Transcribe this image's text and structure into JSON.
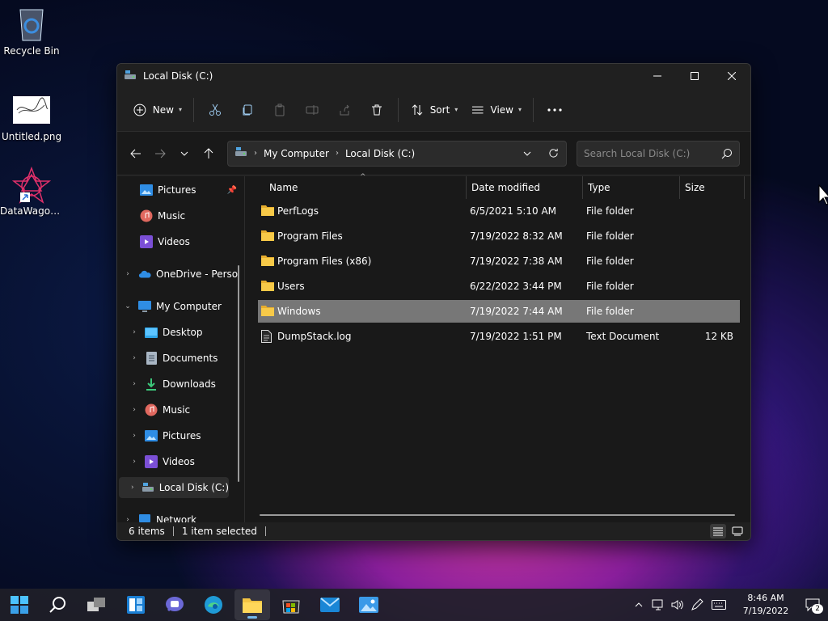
{
  "desktop": {
    "icons": [
      {
        "label": "Recycle Bin",
        "icon": "recycle-bin-icon"
      },
      {
        "label": "Untitled.png",
        "icon": "image-thumbnail-icon"
      },
      {
        "label": "DataWagon...",
        "icon": "datawagon-app-icon"
      }
    ]
  },
  "window": {
    "title": "Local Disk (C:)",
    "toolbar": {
      "new_label": "New",
      "sort_label": "Sort",
      "view_label": "View"
    },
    "address": {
      "crumbs": [
        "My Computer",
        "Local Disk (C:)"
      ]
    },
    "search": {
      "placeholder": "Search Local Disk (C:)"
    },
    "nav_pane": {
      "items": [
        {
          "label": "Pictures",
          "icon": "pictures-icon",
          "pinned": true
        },
        {
          "label": "Music",
          "icon": "music-icon"
        },
        {
          "label": "Videos",
          "icon": "videos-icon"
        },
        {
          "label": "OneDrive - Perso",
          "icon": "onedrive-icon"
        },
        {
          "label": "My Computer",
          "icon": "computer-icon"
        },
        {
          "label": "Desktop",
          "icon": "desktop-icon"
        },
        {
          "label": "Documents",
          "icon": "documents-icon"
        },
        {
          "label": "Downloads",
          "icon": "downloads-icon"
        },
        {
          "label": "Music",
          "icon": "music-icon"
        },
        {
          "label": "Pictures",
          "icon": "pictures-icon"
        },
        {
          "label": "Videos",
          "icon": "videos-icon"
        },
        {
          "label": "Local Disk (C:)",
          "icon": "drive-icon"
        },
        {
          "label": "Network",
          "icon": "network-icon"
        }
      ]
    },
    "columns": {
      "name": "Name",
      "date": "Date modified",
      "type": "Type",
      "size": "Size"
    },
    "files": [
      {
        "name": "PerfLogs",
        "date": "6/5/2021 5:10 AM",
        "type": "File folder",
        "size": "",
        "kind": "folder"
      },
      {
        "name": "Program Files",
        "date": "7/19/2022 8:32 AM",
        "type": "File folder",
        "size": "",
        "kind": "folder"
      },
      {
        "name": "Program Files (x86)",
        "date": "7/19/2022 7:38 AM",
        "type": "File folder",
        "size": "",
        "kind": "folder"
      },
      {
        "name": "Users",
        "date": "6/22/2022 3:44 PM",
        "type": "File folder",
        "size": "",
        "kind": "folder"
      },
      {
        "name": "Windows",
        "date": "7/19/2022 7:44 AM",
        "type": "File folder",
        "size": "",
        "kind": "folder",
        "selected": true
      },
      {
        "name": "DumpStack.log",
        "date": "7/19/2022 1:51 PM",
        "type": "Text Document",
        "size": "12 KB",
        "kind": "file"
      }
    ],
    "status": {
      "count": "6 items",
      "selection": "1 item selected"
    }
  },
  "taskbar": {
    "clock_time": "8:46 AM",
    "clock_date": "7/19/2022",
    "notification_count": "2"
  },
  "colors": {
    "accent": "#76b9ed",
    "folder": "#f3c343",
    "window_bg": "#191919",
    "selected_row": "#777777"
  }
}
